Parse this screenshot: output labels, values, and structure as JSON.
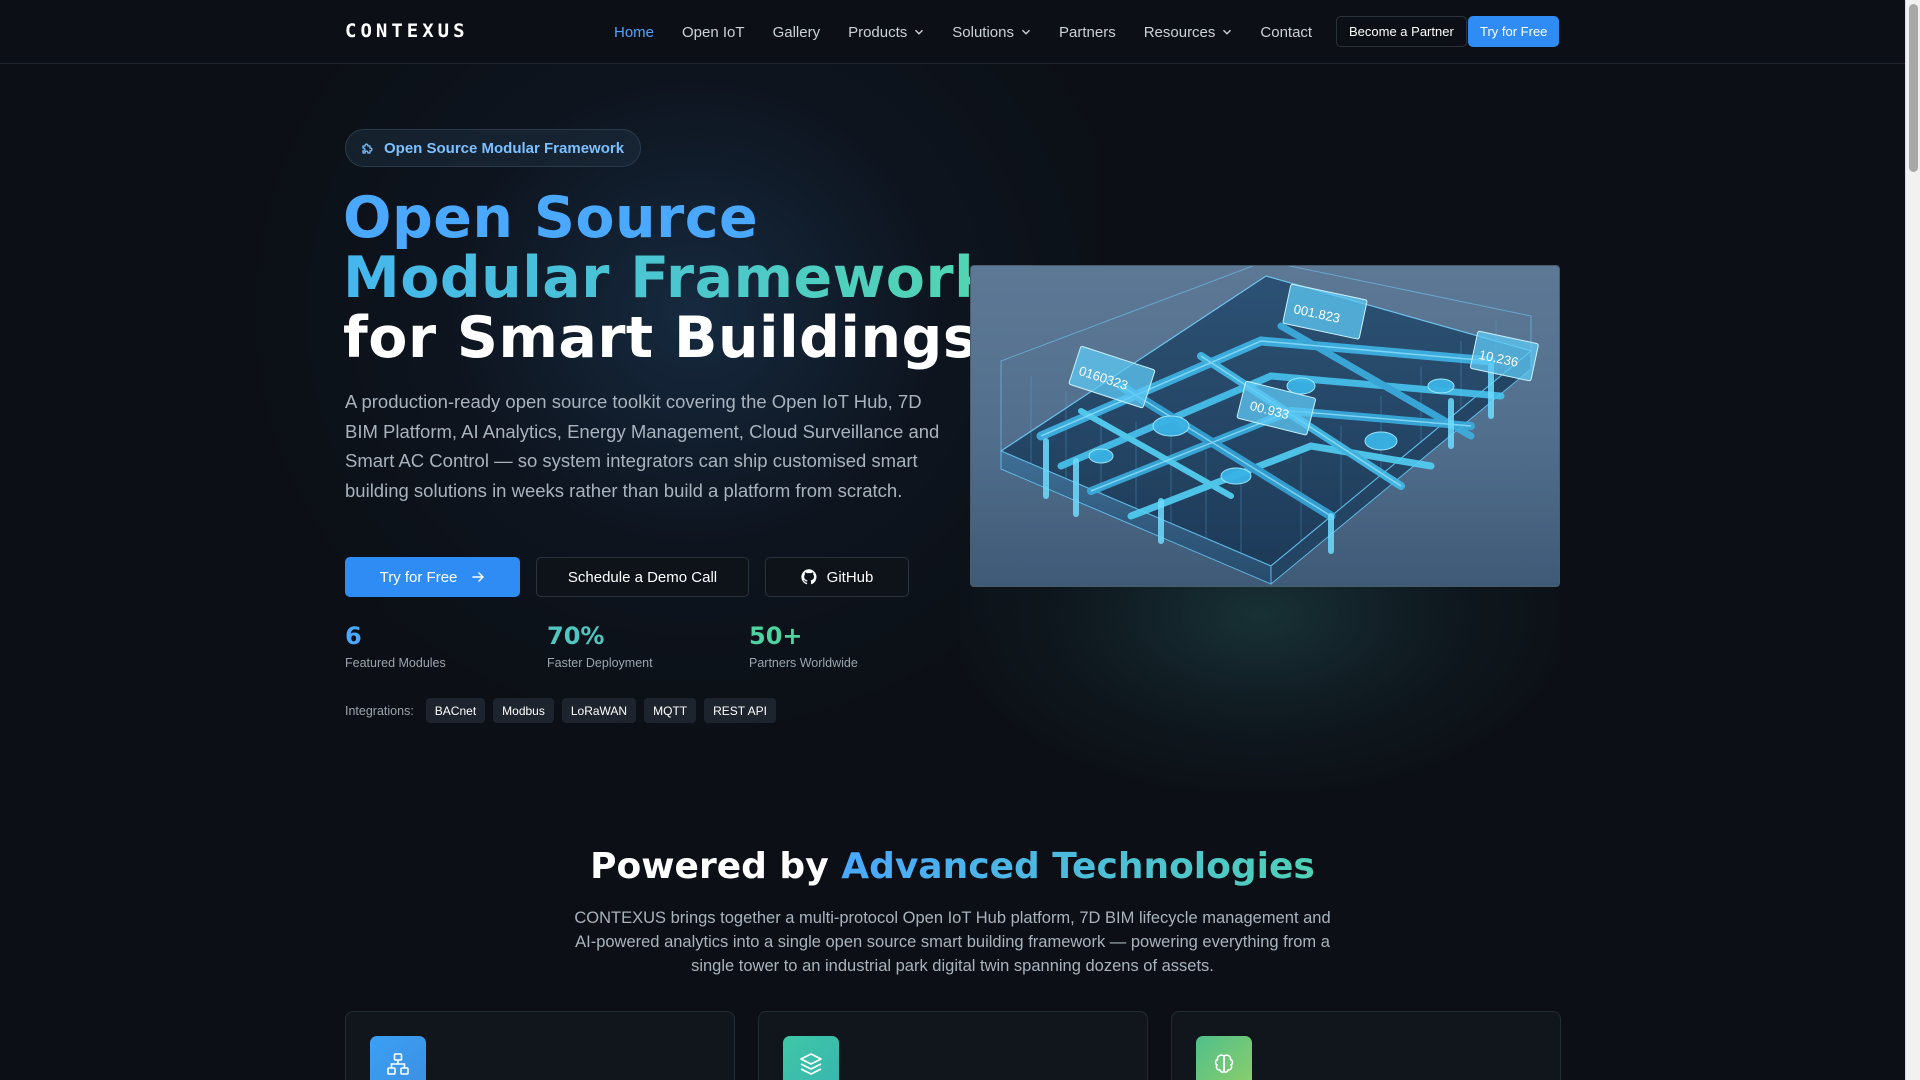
{
  "brand": {
    "logo": "CONTEXUS"
  },
  "nav": {
    "links": [
      {
        "label": "Home",
        "active": true,
        "dropdown": false
      },
      {
        "label": "Open IoT",
        "active": false,
        "dropdown": false
      },
      {
        "label": "Gallery",
        "active": false,
        "dropdown": false
      },
      {
        "label": "Products",
        "active": false,
        "dropdown": true
      },
      {
        "label": "Solutions",
        "active": false,
        "dropdown": true
      },
      {
        "label": "Partners",
        "active": false,
        "dropdown": false
      },
      {
        "label": "Resources",
        "active": false,
        "dropdown": true
      },
      {
        "label": "Contact",
        "active": false,
        "dropdown": false
      }
    ],
    "become_partner": "Become a Partner",
    "try_free": "Try for Free"
  },
  "hero": {
    "badge": "Open Source Modular Framework",
    "headline": {
      "line1": "Open Source",
      "line2": "Modular Framework",
      "line3": "for Smart Buildings"
    },
    "description": "A production-ready open source toolkit covering the Open IoT Hub, 7D BIM Platform, AI Analytics, Energy Management, Cloud Surveillance and Smart AC Control — so system integrators can ship customised smart building solutions in weeks rather than build a platform from scratch.",
    "buttons": {
      "primary": "Try for Free",
      "demo": "Schedule a Demo Call",
      "github": "GitHub"
    },
    "stats": [
      {
        "value": "6",
        "label": "Featured Modules",
        "color": "#4aa8ff"
      },
      {
        "value": "70%",
        "label": "Faster Deployment",
        "color": "#4fc6c0"
      },
      {
        "value": "50+",
        "label": "Partners Worldwide",
        "color": "#4fd1a0"
      }
    ],
    "integrations_label": "Integrations:",
    "integrations": [
      "BACnet",
      "Modbus",
      "LoRaWAN",
      "MQTT",
      "REST API"
    ],
    "image_readouts": [
      "001.823",
      "0160323",
      "00.933",
      "10.236"
    ]
  },
  "section2": {
    "title_plain": "Powered by ",
    "title_accent": "Advanced Technologies",
    "description": "CONTEXUS brings together a multi-protocol Open IoT Hub platform, 7D BIM lifecycle management and AI-powered analytics into a single open source smart building framework — powering everything from a single tower to an industrial park digital twin spanning dozens of assets.",
    "cards": [
      {
        "icon": "network-icon",
        "color": "#3d9cf0"
      },
      {
        "icon": "layers-icon",
        "color": "#3fc3a8"
      },
      {
        "icon": "brain-icon",
        "color": "#6cc28a"
      }
    ]
  },
  "colors": {
    "accent": "#2f8cf5",
    "background": "#0c1016"
  }
}
